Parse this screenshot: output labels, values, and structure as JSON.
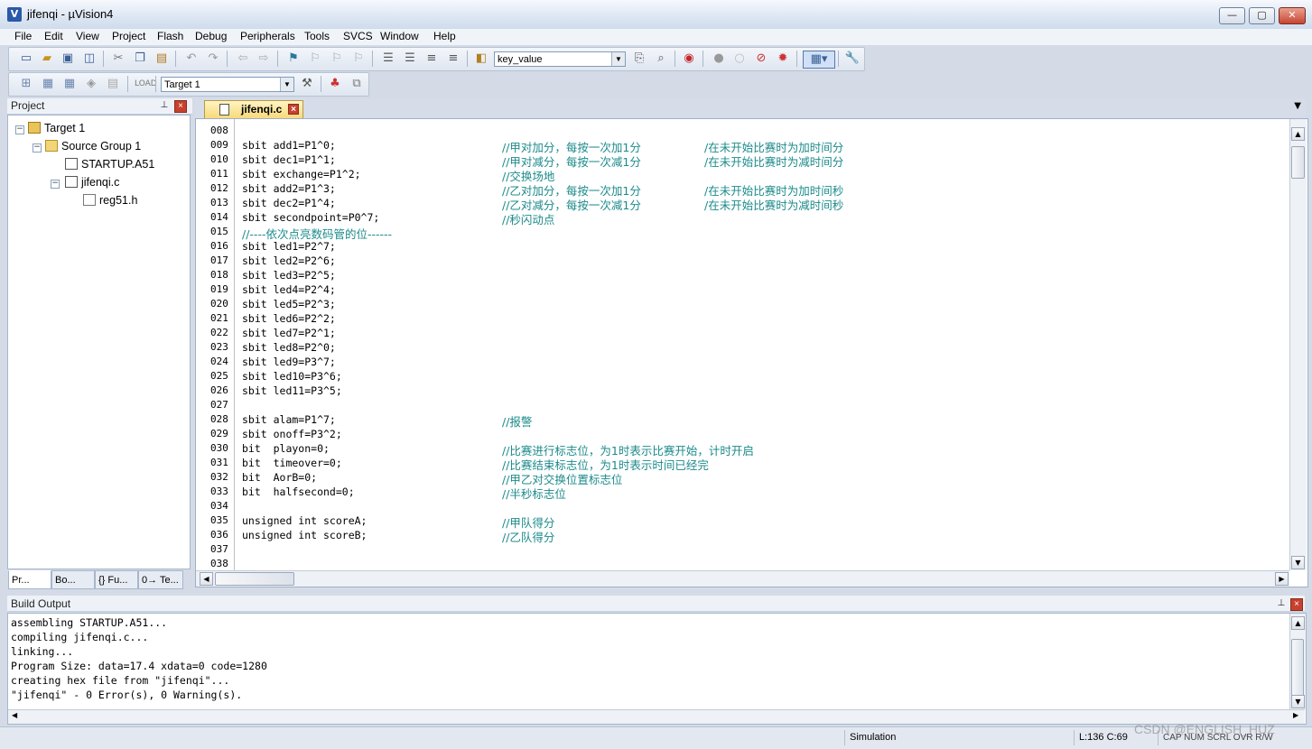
{
  "window": {
    "title": "jifenqi  - µVision4",
    "app_icon": "V",
    "min_label": "—",
    "max_label": "▢",
    "close_label": "✕"
  },
  "menu": [
    "File",
    "Edit",
    "View",
    "Project",
    "Flash",
    "Debug",
    "Peripherals",
    "Tools",
    "SVCS",
    "Window",
    "Help"
  ],
  "toolbar": {
    "find_combo_value": "key_value",
    "target_combo_value": "Target 1"
  },
  "project_panel": {
    "title": "Project",
    "tree": [
      {
        "label": "Target 1"
      },
      {
        "label": "Source Group 1"
      },
      {
        "label": "STARTUP.A51"
      },
      {
        "label": "jifenqi.c"
      },
      {
        "label": "reg51.h"
      }
    ],
    "tabs": [
      "Pr...",
      "Bo...",
      "{} Fu...",
      "0→ Te..."
    ]
  },
  "editor": {
    "tab_label": "jifenqi.c",
    "lines": [
      {
        "n": "008",
        "code": "",
        "comment": "",
        "comment2": ""
      },
      {
        "n": "009",
        "code": "sbit add1=P1^0;",
        "comment": "//甲对加分，每按一次加1分",
        "comment2": "/在未开始比赛时为加时间分"
      },
      {
        "n": "010",
        "code": "sbit dec1=P1^1;",
        "comment": "//甲对减分，每按一次减1分",
        "comment2": "/在未开始比赛时为减时间分"
      },
      {
        "n": "011",
        "code": "sbit exchange=P1^2;",
        "comment": "//交换场地",
        "comment2": ""
      },
      {
        "n": "012",
        "code": "sbit add2=P1^3;",
        "comment": "//乙对加分，每按一次加1分",
        "comment2": "/在未开始比赛时为加时间秒"
      },
      {
        "n": "013",
        "code": "sbit dec2=P1^4;",
        "comment": "//乙对减分，每按一次减1分",
        "comment2": "/在未开始比赛时为减时间秒"
      },
      {
        "n": "014",
        "code": "sbit secondpoint=P0^7;",
        "comment": "//秒闪动点",
        "comment2": ""
      },
      {
        "n": "015",
        "code": "",
        "comment": "",
        "comment2": "",
        "full_comment": "//----依次点亮数码管的位------"
      },
      {
        "n": "016",
        "code": "sbit led1=P2^7;",
        "comment": "",
        "comment2": ""
      },
      {
        "n": "017",
        "code": "sbit led2=P2^6;",
        "comment": "",
        "comment2": ""
      },
      {
        "n": "018",
        "code": "sbit led3=P2^5;",
        "comment": "",
        "comment2": ""
      },
      {
        "n": "019",
        "code": "sbit led4=P2^4;",
        "comment": "",
        "comment2": ""
      },
      {
        "n": "020",
        "code": "sbit led5=P2^3;",
        "comment": "",
        "comment2": ""
      },
      {
        "n": "021",
        "code": "sbit led6=P2^2;",
        "comment": "",
        "comment2": ""
      },
      {
        "n": "022",
        "code": "sbit led7=P2^1;",
        "comment": "",
        "comment2": ""
      },
      {
        "n": "023",
        "code": "sbit led8=P2^0;",
        "comment": "",
        "comment2": ""
      },
      {
        "n": "024",
        "code": "sbit led9=P3^7;",
        "comment": "",
        "comment2": ""
      },
      {
        "n": "025",
        "code": "sbit led10=P3^6;",
        "comment": "",
        "comment2": ""
      },
      {
        "n": "026",
        "code": "sbit led11=P3^5;",
        "comment": "",
        "comment2": ""
      },
      {
        "n": "027",
        "code": "",
        "comment": "",
        "comment2": ""
      },
      {
        "n": "028",
        "code": "sbit alam=P1^7;",
        "comment": "//报警",
        "comment2": ""
      },
      {
        "n": "029",
        "code": "sbit onoff=P3^2;",
        "comment": "",
        "comment2": ""
      },
      {
        "n": "030",
        "code": "bit  playon=0;",
        "comment": "//比赛进行标志位，为1时表示比赛开始，计时开启",
        "comment2": ""
      },
      {
        "n": "031",
        "code": "bit  timeover=0;",
        "comment": "//比赛结束标志位，为1时表示时间已经完",
        "comment2": ""
      },
      {
        "n": "032",
        "code": "bit  AorB=0;",
        "comment": "//甲乙对交换位置标志位",
        "comment2": ""
      },
      {
        "n": "033",
        "code": "bit  halfsecond=0;",
        "comment": "//半秒标志位",
        "comment2": ""
      },
      {
        "n": "034",
        "code": "",
        "comment": "",
        "comment2": ""
      },
      {
        "n": "035",
        "code": "unsigned int scoreA;",
        "comment": "//甲队得分",
        "comment2": ""
      },
      {
        "n": "036",
        "code": "unsigned int scoreB;",
        "comment": "//乙队得分",
        "comment2": ""
      },
      {
        "n": "037",
        "code": "",
        "comment": "",
        "comment2": ""
      },
      {
        "n": "038",
        "code": "",
        "comment": "",
        "comment2": ""
      }
    ]
  },
  "build_output": {
    "title": "Build Output",
    "lines": [
      "assembling STARTUP.A51...",
      "compiling jifenqi.c...",
      "linking...",
      "Program Size: data=17.4 xdata=0 code=1280",
      "creating hex file from \"jifenqi\"...",
      "\"jifenqi\" - 0 Error(s), 0 Warning(s)."
    ]
  },
  "statusbar": {
    "mode": "Simulation",
    "position": "L:136 C:69",
    "flags": "CAP  NUM  SCRL  OVR  R/W"
  },
  "watermark": "CSDN @ENGLISH_HUZ"
}
